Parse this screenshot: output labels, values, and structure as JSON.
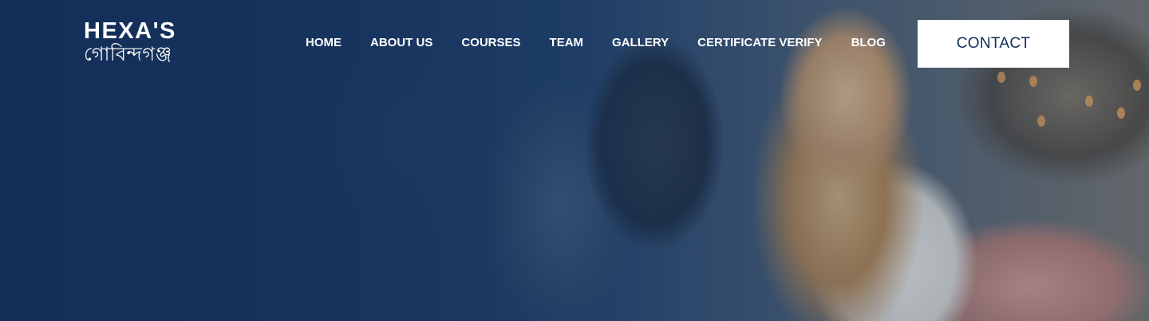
{
  "brand": {
    "name": "HEXA'S",
    "tagline": "গোবিন্দগঞ্জ"
  },
  "nav": {
    "items": [
      "HOME",
      "ABOUT US",
      "COURSES",
      "TEAM",
      "GALLERY",
      "CERTIFICATE VERIFY",
      "BLOG"
    ]
  },
  "cta": {
    "label": "CONTACT"
  },
  "colors": {
    "overlay": "#16325c",
    "button_bg": "#ffffff",
    "button_text": "#0e2d5a",
    "nav_text": "#ffffff"
  }
}
